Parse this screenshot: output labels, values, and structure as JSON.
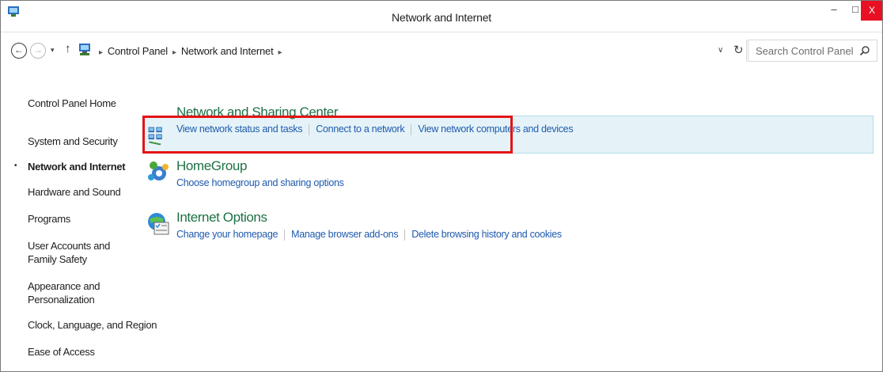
{
  "window": {
    "title": "Network and Internet",
    "min_glyph": "–",
    "max_glyph": "□",
    "close_glyph": "X"
  },
  "address": {
    "back_glyph": "←",
    "fwd_glyph": "→",
    "recent_glyph": "▾",
    "up_glyph": "↑",
    "crumbs": [
      "Control Panel",
      "Network and Internet"
    ],
    "crumb_sep": "▸",
    "dropdown_glyph": "∨",
    "refresh_glyph": "↻",
    "search_placeholder": "Search Control Panel"
  },
  "sidebar": {
    "items": [
      {
        "label": "Control Panel Home"
      },
      {
        "label": "System and Security"
      },
      {
        "label": "Network and Internet",
        "active": true
      },
      {
        "label": "Hardware and Sound"
      },
      {
        "label": "Programs"
      },
      {
        "label": "User Accounts and Family Safety"
      },
      {
        "label": "Appearance and Personalization"
      },
      {
        "label": "Clock, Language, and Region"
      },
      {
        "label": "Ease of Access"
      }
    ],
    "bullet": "•"
  },
  "categories": [
    {
      "title": "Network and Sharing Center",
      "icon": "network-sharing-icon",
      "links": [
        "View network status and tasks",
        "Connect to a network",
        "View network computers and devices"
      ]
    },
    {
      "title": "HomeGroup",
      "icon": "homegroup-icon",
      "links": [
        "Choose homegroup and sharing options"
      ]
    },
    {
      "title": "Internet Options",
      "icon": "internet-options-icon",
      "links": [
        "Change your homepage",
        "Manage browser add-ons",
        "Delete browsing history and cookies"
      ]
    }
  ],
  "colors": {
    "category_title": "#1e7145",
    "link": "#1f5aad",
    "highlight_bg": "#e5f3f8",
    "red_box": "#e31414",
    "close_bg": "#e81123"
  }
}
